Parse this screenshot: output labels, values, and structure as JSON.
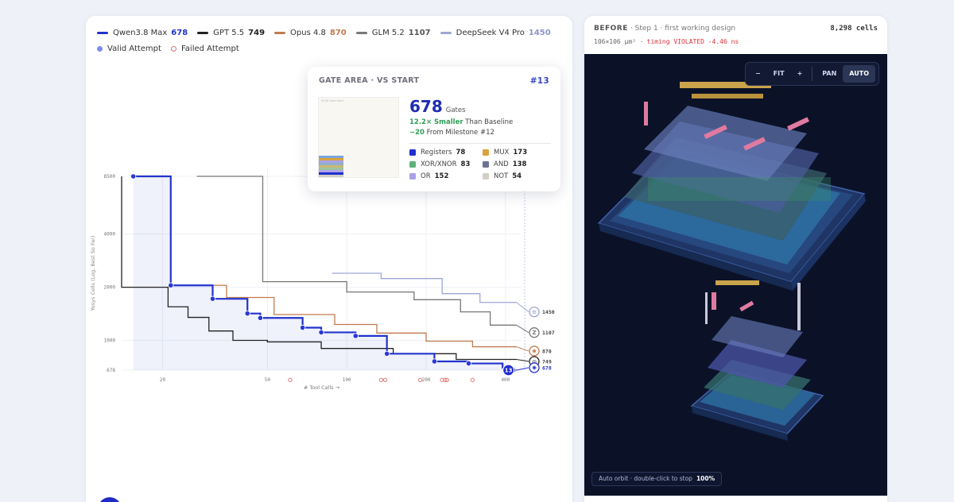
{
  "left_panel": {
    "legend": [
      {
        "name": "Qwen3.8 Max",
        "value": "678",
        "color": "#2233cc"
      },
      {
        "name": "GPT 5.5",
        "value": "749",
        "color": "#222222"
      },
      {
        "name": "Opus 4.8",
        "value": "870",
        "color": "#c17a4d"
      },
      {
        "name": "GLM 5.2",
        "value": "1107",
        "color": "#777777"
      },
      {
        "name": "DeepSeek V4 Pro",
        "value": "1450",
        "color": "#9ea6d4"
      }
    ],
    "legend_markers": {
      "valid": "Valid Attempt",
      "failed": "Failed Attempt"
    }
  },
  "chart_data": {
    "type": "line",
    "step": true,
    "x_scale": "log",
    "y_scale": "log",
    "xlabel": "# Tool Calls →",
    "ylabel": "Yosys Cells (Log, Best So Far)",
    "x_ticks": [
      "20",
      "50",
      "100",
      "200",
      "400"
    ],
    "y_ticks": [
      "678",
      "1000",
      "2000",
      "4000",
      "8500"
    ],
    "xlim": [
      14,
      460
    ],
    "ylim": [
      678,
      8500
    ],
    "series": [
      {
        "name": "Qwen3.8 Max",
        "color": "#2233cc",
        "final": "678",
        "points": [
          [
            15.5,
            8500
          ],
          [
            21.5,
            8500
          ],
          [
            21.5,
            2050
          ],
          [
            31,
            2050
          ],
          [
            31,
            1720
          ],
          [
            42,
            1720
          ],
          [
            42,
            1420
          ],
          [
            47,
            1420
          ],
          [
            47,
            1340
          ],
          [
            68,
            1340
          ],
          [
            68,
            1180
          ],
          [
            80,
            1180
          ],
          [
            80,
            1110
          ],
          [
            108,
            1110
          ],
          [
            108,
            1060
          ],
          [
            142,
            1060
          ],
          [
            142,
            840
          ],
          [
            215,
            840
          ],
          [
            215,
            760
          ],
          [
            290,
            760
          ],
          [
            290,
            740
          ],
          [
            390,
            740
          ],
          [
            390,
            700
          ],
          [
            428,
            700
          ],
          [
            428,
            678
          ],
          [
            440,
            678
          ]
        ],
        "valid_points": [
          [
            15.5,
            8500
          ],
          [
            21.5,
            2050
          ],
          [
            31,
            1720
          ],
          [
            42,
            1420
          ],
          [
            47,
            1340
          ],
          [
            68,
            1180
          ],
          [
            80,
            1110
          ],
          [
            108,
            1060
          ],
          [
            142,
            840
          ],
          [
            215,
            760
          ],
          [
            290,
            740
          ],
          [
            428,
            678
          ]
        ]
      },
      {
        "name": "GPT 5.5",
        "color": "#222222",
        "final": "749",
        "points": [
          [
            14,
            8500
          ],
          [
            14,
            2000
          ],
          [
            21,
            2000
          ],
          [
            21,
            1550
          ],
          [
            25,
            1550
          ],
          [
            25,
            1350
          ],
          [
            30,
            1350
          ],
          [
            30,
            1130
          ],
          [
            37,
            1130
          ],
          [
            37,
            1000
          ],
          [
            50,
            1000
          ],
          [
            50,
            980
          ],
          [
            80,
            980
          ],
          [
            80,
            900
          ],
          [
            150,
            900
          ],
          [
            150,
            840
          ],
          [
            260,
            840
          ],
          [
            260,
            780
          ],
          [
            440,
            780
          ]
        ]
      },
      {
        "name": "Opus 4.8",
        "color": "#c17a4d",
        "final": "870",
        "points": [
          [
            21.5,
            2050
          ],
          [
            35,
            2050
          ],
          [
            35,
            1750
          ],
          [
            53,
            1750
          ],
          [
            53,
            1400
          ],
          [
            90,
            1400
          ],
          [
            90,
            1230
          ],
          [
            130,
            1230
          ],
          [
            130,
            1100
          ],
          [
            200,
            1100
          ],
          [
            200,
            990
          ],
          [
            300,
            990
          ],
          [
            300,
            920
          ],
          [
            440,
            920
          ]
        ]
      },
      {
        "name": "GLM 5.2",
        "color": "#777777",
        "final": "1107",
        "points": [
          [
            27,
            8500
          ],
          [
            48,
            8500
          ],
          [
            48,
            2150
          ],
          [
            100,
            2150
          ],
          [
            100,
            1880
          ],
          [
            180,
            1880
          ],
          [
            180,
            1700
          ],
          [
            270,
            1700
          ],
          [
            270,
            1450
          ],
          [
            350,
            1450
          ],
          [
            350,
            1220
          ],
          [
            440,
            1220
          ]
        ]
      },
      {
        "name": "DeepSeek V4 Pro",
        "color": "#9ea6d4",
        "final": "1450",
        "points": [
          [
            88,
            2400
          ],
          [
            135,
            2400
          ],
          [
            135,
            2240
          ],
          [
            230,
            2240
          ],
          [
            230,
            1840
          ],
          [
            320,
            1840
          ],
          [
            320,
            1640
          ],
          [
            440,
            1640
          ]
        ]
      }
    ],
    "failed_points": [
      [
        61,
        690
      ],
      [
        135,
        690
      ],
      [
        140,
        690
      ],
      [
        190,
        690
      ],
      [
        230,
        690
      ],
      [
        236,
        690
      ],
      [
        240,
        690
      ],
      [
        300,
        690
      ]
    ],
    "end_labels": [
      "1450",
      "1107",
      "870",
      "749",
      "678"
    ],
    "end_icon_glyphs": [
      "≋",
      "Z",
      "✱",
      "◎",
      "✺"
    ],
    "selected_marker": "13"
  },
  "tooltip": {
    "title": "GATE AREA · VS START",
    "milestone": "#13",
    "thumb_label": "8206 Gate Start",
    "gates": "678",
    "gates_unit": "Gates",
    "smaller_ratio": "12.2× Smaller",
    "smaller_suffix": "Than Baseline",
    "delta": "−20",
    "delta_suffix": "From Milestone #12",
    "breakdown": [
      {
        "label": "Registers",
        "value": "78",
        "color": "#1f2ed0"
      },
      {
        "label": "MUX",
        "value": "173",
        "color": "#d9a33b"
      },
      {
        "label": "XOR/XNOR",
        "value": "83",
        "color": "#5fb07a"
      },
      {
        "label": "AND",
        "value": "138",
        "color": "#6b7390"
      },
      {
        "label": "OR",
        "value": "152",
        "color": "#a7a2e6"
      },
      {
        "label": "NOT",
        "value": "54",
        "color": "#d3cfc4"
      }
    ]
  },
  "right_panel": {
    "stage": "BEFORE",
    "step": "· Step 1 · first working design",
    "cells": "8,298 cells",
    "area": "106×106 µm²",
    "sep": "·",
    "timing": "timing VIOLATED -4.46 ns",
    "controls": [
      "−",
      "FIT",
      "+",
      "PAN",
      "AUTO"
    ],
    "active_control": "AUTO",
    "orbit_label": "Auto orbit · double-click to stop",
    "orbit_value": "100%"
  }
}
